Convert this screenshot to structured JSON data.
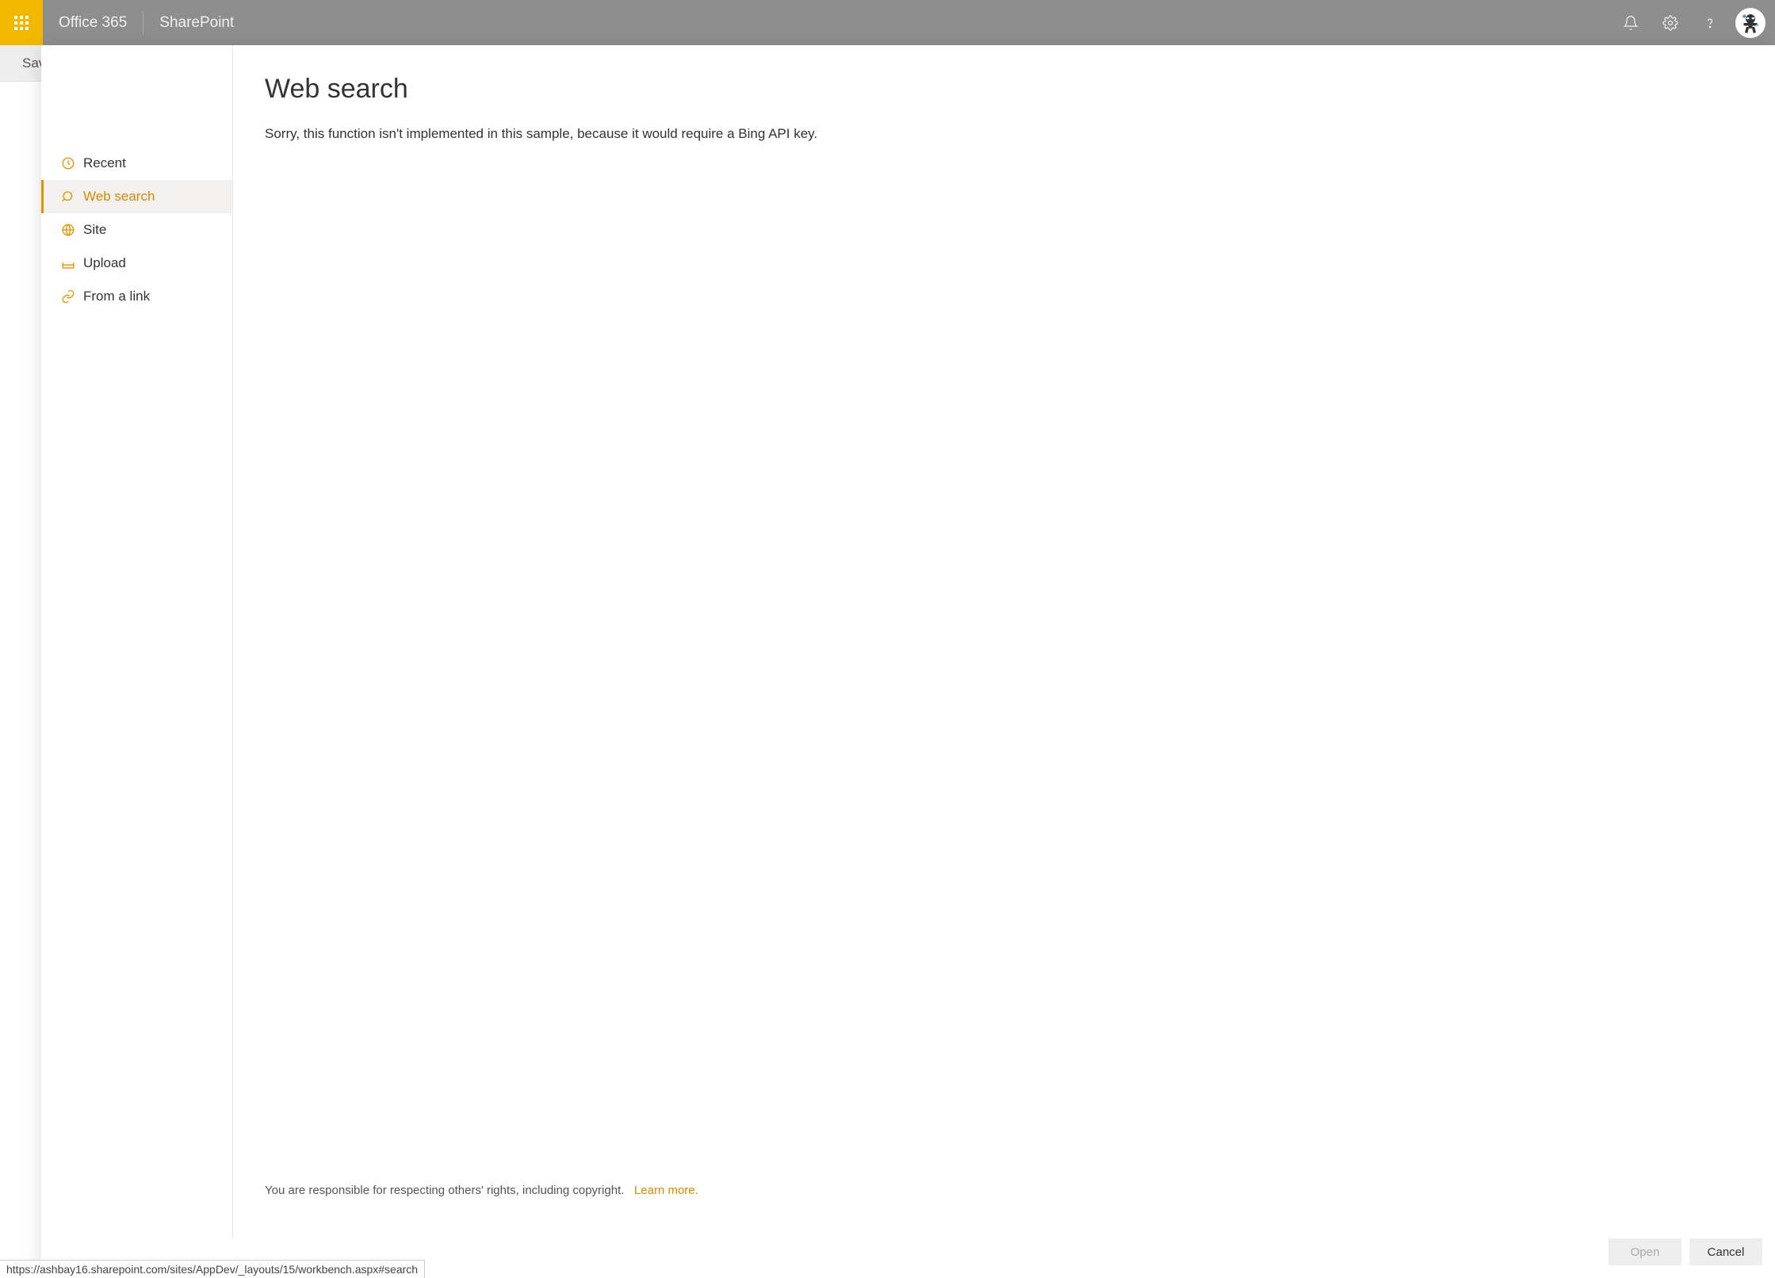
{
  "header": {
    "brand1": "Office 365",
    "brand2": "SharePoint"
  },
  "subbar": {
    "label": "Save"
  },
  "sidebar": {
    "items": [
      {
        "label": "Recent",
        "icon": "clock-icon"
      },
      {
        "label": "Web search",
        "icon": "search-icon"
      },
      {
        "label": "Site",
        "icon": "globe-icon"
      },
      {
        "label": "Upload",
        "icon": "upload-icon"
      },
      {
        "label": "From a link",
        "icon": "link-icon"
      }
    ],
    "active_index": 1
  },
  "main": {
    "title": "Web search",
    "message": "Sorry, this function isn't implemented in this sample, because it would require a Bing API key."
  },
  "footer": {
    "copyright_text": "You are responsible for respecting others' rights, including copyright.",
    "learn_more": "Learn more.",
    "open_label": "Open",
    "cancel_label": "Cancel"
  },
  "statusbar": {
    "url": "https://ashbay16.sharepoint.com/sites/AppDev/_layouts/15/workbench.aspx#search"
  }
}
